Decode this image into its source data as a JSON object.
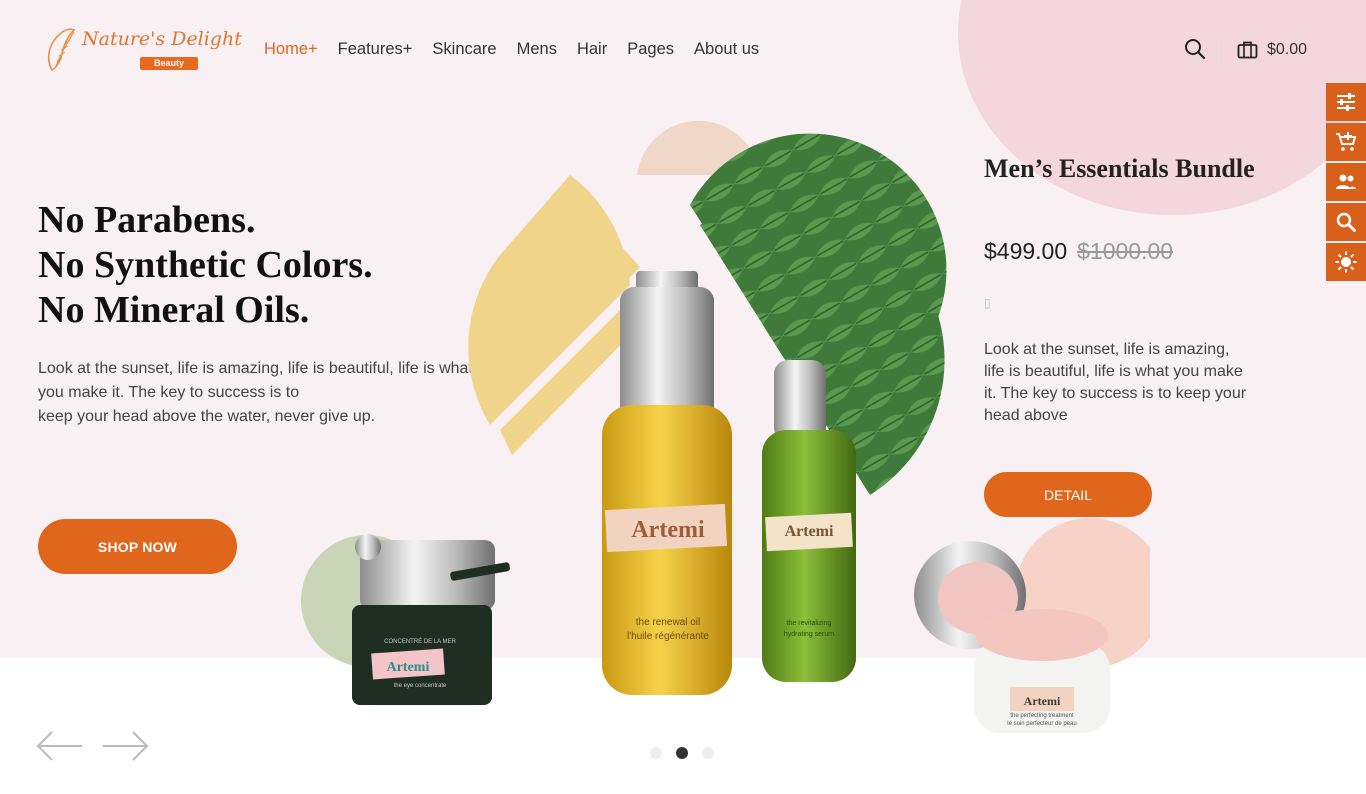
{
  "brand": {
    "name": "Nature's Delight",
    "tagline": "Beauty",
    "accent": "#e0661c"
  },
  "nav": {
    "items": [
      {
        "label": "Home+",
        "active": true
      },
      {
        "label": "Features+"
      },
      {
        "label": "Skincare"
      },
      {
        "label": "Mens"
      },
      {
        "label": "Hair"
      },
      {
        "label": "Pages"
      },
      {
        "label": "About us"
      }
    ]
  },
  "header": {
    "search_icon": "search-icon",
    "cart_icon": "shopping-bag-icon",
    "cart_total": "$0.00"
  },
  "side_toolbar": {
    "items": [
      "sliders-icon",
      "add-cart-icon",
      "users-icon",
      "search-icon",
      "brightness-icon"
    ]
  },
  "hero": {
    "title_lines": [
      "No Parabens.",
      "No Synthetic Colors.",
      "No Mineral Oils."
    ],
    "desc_lines": [
      "Look at the sunset, life is amazing, life is beautiful, life is what",
      "you make it. The key to success is to",
      "keep your head above the water, never give up."
    ],
    "cta": "SHOP NOW"
  },
  "product": {
    "title": "Men’s Essentials Bundle",
    "price_now": "$499.00",
    "price_old": "$1000.00",
    "glyph": "▯",
    "desc": "Look at the sunset, life is amazing, life is beautiful, life is what you make it. The key to success is to keep your head above",
    "cta": "DETAIL"
  },
  "products_art": {
    "jar_left": {
      "brand": "Artemi",
      "line1": "CONCENTRÉ DE LA MER",
      "line2": "the eye concentrate"
    },
    "bottle_big": {
      "brand": "Artemi",
      "line1": "the renewal oil",
      "line2": "l'huile régénérante"
    },
    "bottle_green": {
      "brand": "Artemi",
      "line1": "the revitalizing",
      "line2": "hydrating serum"
    },
    "jar_right": {
      "brand": "Artemi",
      "line1": "the perfecting treatment",
      "line2": "le soin perfecteur de peau"
    }
  },
  "carousel": {
    "dots": 3,
    "active_dot": 2,
    "prev_icon": "arrow-left-icon",
    "next_icon": "arrow-right-icon"
  }
}
